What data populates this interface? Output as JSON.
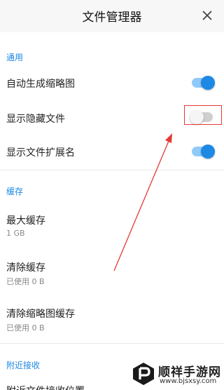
{
  "header": {
    "title": "文件管理器",
    "close_icon": "close-icon"
  },
  "sections": {
    "general": {
      "title": "通用",
      "items": [
        {
          "label": "自动生成缩略图",
          "toggle": "on"
        },
        {
          "label": "显示隐藏文件",
          "toggle": "off"
        },
        {
          "label": "显示文件扩展名",
          "toggle": "on"
        }
      ]
    },
    "cache": {
      "title": "缓存",
      "items": [
        {
          "label": "最大缓存",
          "value": "1 GB"
        },
        {
          "label": "清除缓存",
          "value": "已使用 0 B"
        },
        {
          "label": "清除缩略图缓存",
          "value": "已使用 0 B"
        }
      ]
    },
    "nearby": {
      "title": "附近接收",
      "partial_item": "附近文件接收位置"
    }
  },
  "watermark": {
    "name": "顺祥手游网",
    "url": "www.bjsxsy.com"
  },
  "colors": {
    "accent": "#1e88e5",
    "highlight": "#e53935"
  }
}
